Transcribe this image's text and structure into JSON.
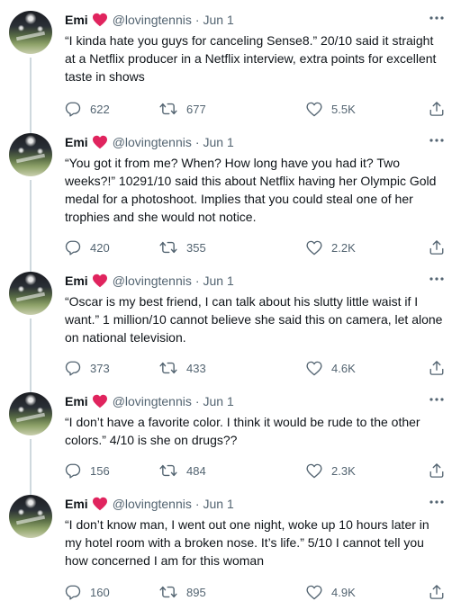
{
  "tweets": [
    {
      "name": "Emi",
      "handle": "@lovingtennis",
      "dot": "·",
      "date": "Jun 1",
      "text": "“I kinda hate you guys for canceling Sense8.” 20/10 said it straight at a Netflix producer in a Netflix interview, extra points for excellent taste in shows",
      "replies": "622",
      "retweets": "677",
      "likes": "5.5K"
    },
    {
      "name": "Emi",
      "handle": "@lovingtennis",
      "dot": "·",
      "date": "Jun 1",
      "text": "“You got it from me? When? How long have you had it? Two weeks?!” 10291/10 said this about Netflix having her Olympic Gold medal for a photoshoot. Implies that you could steal one of her trophies and she would not notice.",
      "replies": "420",
      "retweets": "355",
      "likes": "2.2K"
    },
    {
      "name": "Emi",
      "handle": "@lovingtennis",
      "dot": "·",
      "date": "Jun 1",
      "text": "“Oscar is my best friend, I can talk about his slutty little waist if I want.” 1 million/10 cannot believe she said this on camera, let alone on national television.",
      "replies": "373",
      "retweets": "433",
      "likes": "4.6K"
    },
    {
      "name": "Emi",
      "handle": "@lovingtennis",
      "dot": "·",
      "date": "Jun 1",
      "text": "“I don’t have a favorite color. I think it would be rude to the other colors.” 4/10 is she on drugs??",
      "replies": "156",
      "retweets": "484",
      "likes": "2.3K"
    },
    {
      "name": "Emi",
      "handle": "@lovingtennis",
      "dot": "·",
      "date": "Jun 1",
      "text": "“I don’t know man, I went out one night, woke up 10 hours later in my hotel room with a broken nose. It’s life.” 5/10 I cannot tell you how concerned I am for this woman",
      "replies": "160",
      "retweets": "895",
      "likes": "4.9K"
    }
  ],
  "icons": {
    "name_badge": "red-heart-icon",
    "more": "more-options-icon",
    "reply": "reply-icon",
    "retweet": "retweet-icon",
    "like": "like-icon",
    "share": "share-icon"
  },
  "colors": {
    "heart": "#e0245e",
    "text": "#0f1419",
    "secondary": "#536471",
    "thread_line": "#cfd9de"
  }
}
